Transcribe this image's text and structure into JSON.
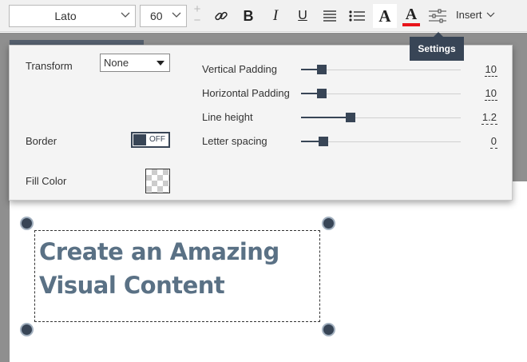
{
  "toolbar": {
    "font_family": "Lato",
    "font_size": "60",
    "stepper_up": "+",
    "stepper_down": "−",
    "bold_label": "B",
    "italic_label": "I",
    "underline_label": "U",
    "font_style_label": "A",
    "font_color_label": "A",
    "font_color_value": "#e8141a",
    "insert_label": "Insert"
  },
  "tooltip": {
    "text": "Settings"
  },
  "settings_panel": {
    "transform": {
      "label": "Transform",
      "value": "None"
    },
    "border": {
      "label": "Border",
      "toggle_text": "OFF",
      "enabled": false
    },
    "fill_color": {
      "label": "Fill Color",
      "value": "transparent"
    },
    "sliders": [
      {
        "label": "Vertical Padding",
        "value": "10",
        "fill": 0.13
      },
      {
        "label": "Horizontal Padding",
        "value": "10",
        "fill": 0.13
      },
      {
        "label": "Line height",
        "value": "1.2",
        "fill": 0.31
      },
      {
        "label": "Letter spacing",
        "value": "0",
        "fill": 0.14
      }
    ]
  },
  "canvas": {
    "text_lines": [
      "Create an Amazing",
      "Visual Content"
    ],
    "text_color": "#5a7185"
  },
  "colors": {
    "accent": "#384556",
    "toolbar_bg": "#f1f1f1",
    "canvas_bg": "#8f8f8f"
  }
}
